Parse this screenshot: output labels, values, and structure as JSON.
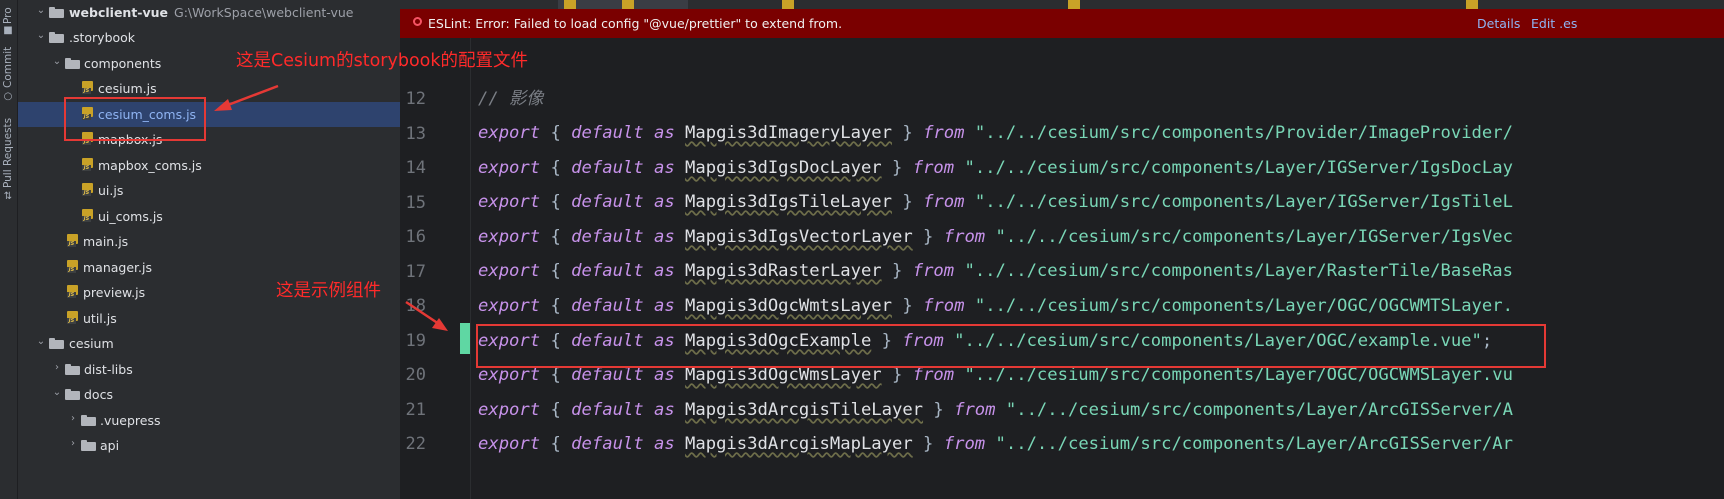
{
  "tool_window_strip": {
    "items": [
      {
        "label": "Pro",
        "icon": "folder-icon"
      },
      {
        "label": "Commit",
        "icon": "commit-icon"
      },
      {
        "label": "Pull Requests",
        "icon": "pull-request-icon"
      }
    ]
  },
  "project_tree": {
    "root": {
      "name": "webclient-vue",
      "path": "G:\\WorkSpace\\webclient-vue"
    },
    "rows": [
      {
        "label": ".storybook",
        "type": "folder",
        "expanded": true
      },
      {
        "label": "components",
        "type": "folder",
        "expanded": true
      },
      {
        "label": "cesium.js",
        "type": "js"
      },
      {
        "label": "cesium_coms.js",
        "type": "js",
        "selected": true
      },
      {
        "label": "mapbox.js",
        "type": "js"
      },
      {
        "label": "mapbox_coms.js",
        "type": "js"
      },
      {
        "label": "ui.js",
        "type": "js"
      },
      {
        "label": "ui_coms.js",
        "type": "js"
      },
      {
        "label": "main.js",
        "type": "js"
      },
      {
        "label": "manager.js",
        "type": "js"
      },
      {
        "label": "preview.js",
        "type": "js"
      },
      {
        "label": "util.js",
        "type": "js"
      },
      {
        "label": "cesium",
        "type": "folder",
        "expanded": true
      },
      {
        "label": "dist-libs",
        "type": "folder",
        "expanded": false
      },
      {
        "label": "docs",
        "type": "folder",
        "expanded": true
      },
      {
        "label": ".vuepress",
        "type": "folder",
        "expanded": false
      },
      {
        "label": "api",
        "type": "folder",
        "expanded": false
      }
    ]
  },
  "eslint_banner": {
    "message": "ESLint: Error: Failed to load config \"@vue/prettier\" to extend from.",
    "actions": [
      "Details",
      "Edit .es"
    ],
    "color": "#7a0000"
  },
  "editor": {
    "lines": [
      {
        "number": "12",
        "comment": "// 影像"
      },
      {
        "number": "13",
        "name": "Mapgis3dImageryLayer",
        "path": "\"../../cesium/src/components/Provider/ImageProvider/"
      },
      {
        "number": "14",
        "name": "Mapgis3dIgsDocLayer",
        "path": "\"../../cesium/src/components/Layer/IGServer/IgsDocLay"
      },
      {
        "number": "15",
        "name": "Mapgis3dIgsTileLayer",
        "path": "\"../../cesium/src/components/Layer/IGServer/IgsTileL"
      },
      {
        "number": "16",
        "name": "Mapgis3dIgsVectorLayer",
        "path": "\"../../cesium/src/components/Layer/IGServer/IgsVec"
      },
      {
        "number": "17",
        "name": "Mapgis3dRasterLayer",
        "path": "\"../../cesium/src/components/Layer/RasterTile/BaseRas"
      },
      {
        "number": "18",
        "name": "Mapgis3dOgcWmtsLayer",
        "path": "\"../../cesium/src/components/Layer/OGC/OGCWMTSLayer."
      },
      {
        "number": "19",
        "name": "Mapgis3dOgcExample",
        "path": "\"../../cesium/src/components/Layer/OGC/example.vue\"",
        "tail": ";"
      },
      {
        "number": "20",
        "name": "Mapgis3dOgcWmsLayer",
        "path": "\"../../cesium/src/components/Layer/OGC/OGCWMSLayer.vu"
      },
      {
        "number": "21",
        "name": "Mapgis3dArcgisTileLayer",
        "path": "\"../../cesium/src/components/Layer/ArcGISServer/A"
      },
      {
        "number": "22",
        "name": "Mapgis3dArcgisMapLayer",
        "path": "\"../../cesium/src/components/Layer/ArcGISServer/Ar"
      }
    ],
    "keywords": {
      "export": "export",
      "default": "default",
      "as": "as",
      "from": "from",
      "open": "{",
      "close": "}"
    }
  },
  "annotations": {
    "config_note": "这是Cesium的storybook的配置文件",
    "example_note": "这是示例组件",
    "color": "#e53935"
  }
}
